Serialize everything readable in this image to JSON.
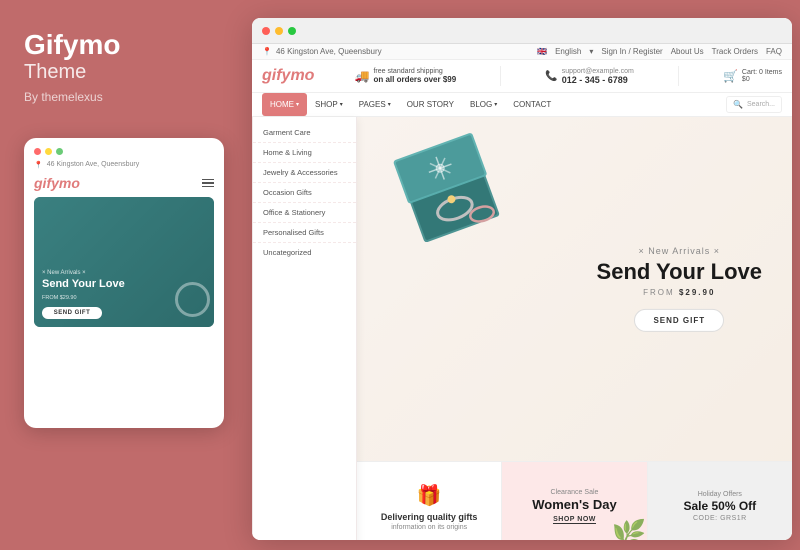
{
  "left": {
    "brand": "Gifymo",
    "theme": "Theme",
    "by": "By themelexus",
    "mobile_dots": [
      "red",
      "yellow",
      "green"
    ],
    "mobile_address": "46 Kingston Ave, Queensbury",
    "mobile_logo": "gifymo",
    "mobile_new_arrivals": "× New Arrivals ×",
    "mobile_hero_title": "Send Your Love",
    "mobile_hero_from": "FROM  $29.90",
    "mobile_send_btn": "SEND GIFT"
  },
  "browser": {
    "dots": [
      "red",
      "yellow",
      "green"
    ],
    "utility": {
      "address": "46 Kingston Ave, Queensbury",
      "language": "English",
      "links": [
        "Sign In / Register",
        "About Us",
        "Track Orders",
        "FAQ"
      ]
    },
    "header": {
      "logo": "gifymo",
      "shipping_top": "free standard shipping",
      "shipping_bottom": "on all orders over $99",
      "support_email": "support@example.com",
      "support_phone": "012 - 345 - 6789",
      "cart_label": "Cart:",
      "cart_items": "0 Items",
      "cart_amount": "$0"
    },
    "nav": {
      "items": [
        {
          "label": "HOME",
          "active": true,
          "has_arrow": true
        },
        {
          "label": "SHOP",
          "active": false,
          "has_arrow": true
        },
        {
          "label": "PAGES",
          "active": false,
          "has_arrow": true
        },
        {
          "label": "OUR STORY",
          "active": false,
          "has_arrow": false
        },
        {
          "label": "BLOG",
          "active": false,
          "has_arrow": true
        },
        {
          "label": "CONTACT",
          "active": false,
          "has_arrow": false
        }
      ],
      "search_placeholder": "Search..."
    },
    "dropdown": {
      "items": [
        "Garment Care",
        "Home & Living",
        "Jewelry & Accessories",
        "Occasion Gifts",
        "Office & Stationery",
        "Personalised Gifts",
        "Uncategorized"
      ]
    },
    "hero": {
      "new_arrivals": "× New Arrivals ×",
      "title": "Send Your Love",
      "from_label": "FROM",
      "price": "$29.90",
      "btn_label": "SEND GIFT"
    },
    "bottom_cards": [
      {
        "type": "gift",
        "title": "Delivering quality gifts",
        "sub": "information on its origins"
      },
      {
        "type": "womens",
        "sale_label": "Clearance Sale",
        "title": "Women's Day",
        "btn_label": "SHOP NOW"
      },
      {
        "type": "holiday",
        "tag": "Holiday Offers",
        "title": "Sale 50% Off",
        "code": "CODE: GRS1R"
      }
    ]
  }
}
